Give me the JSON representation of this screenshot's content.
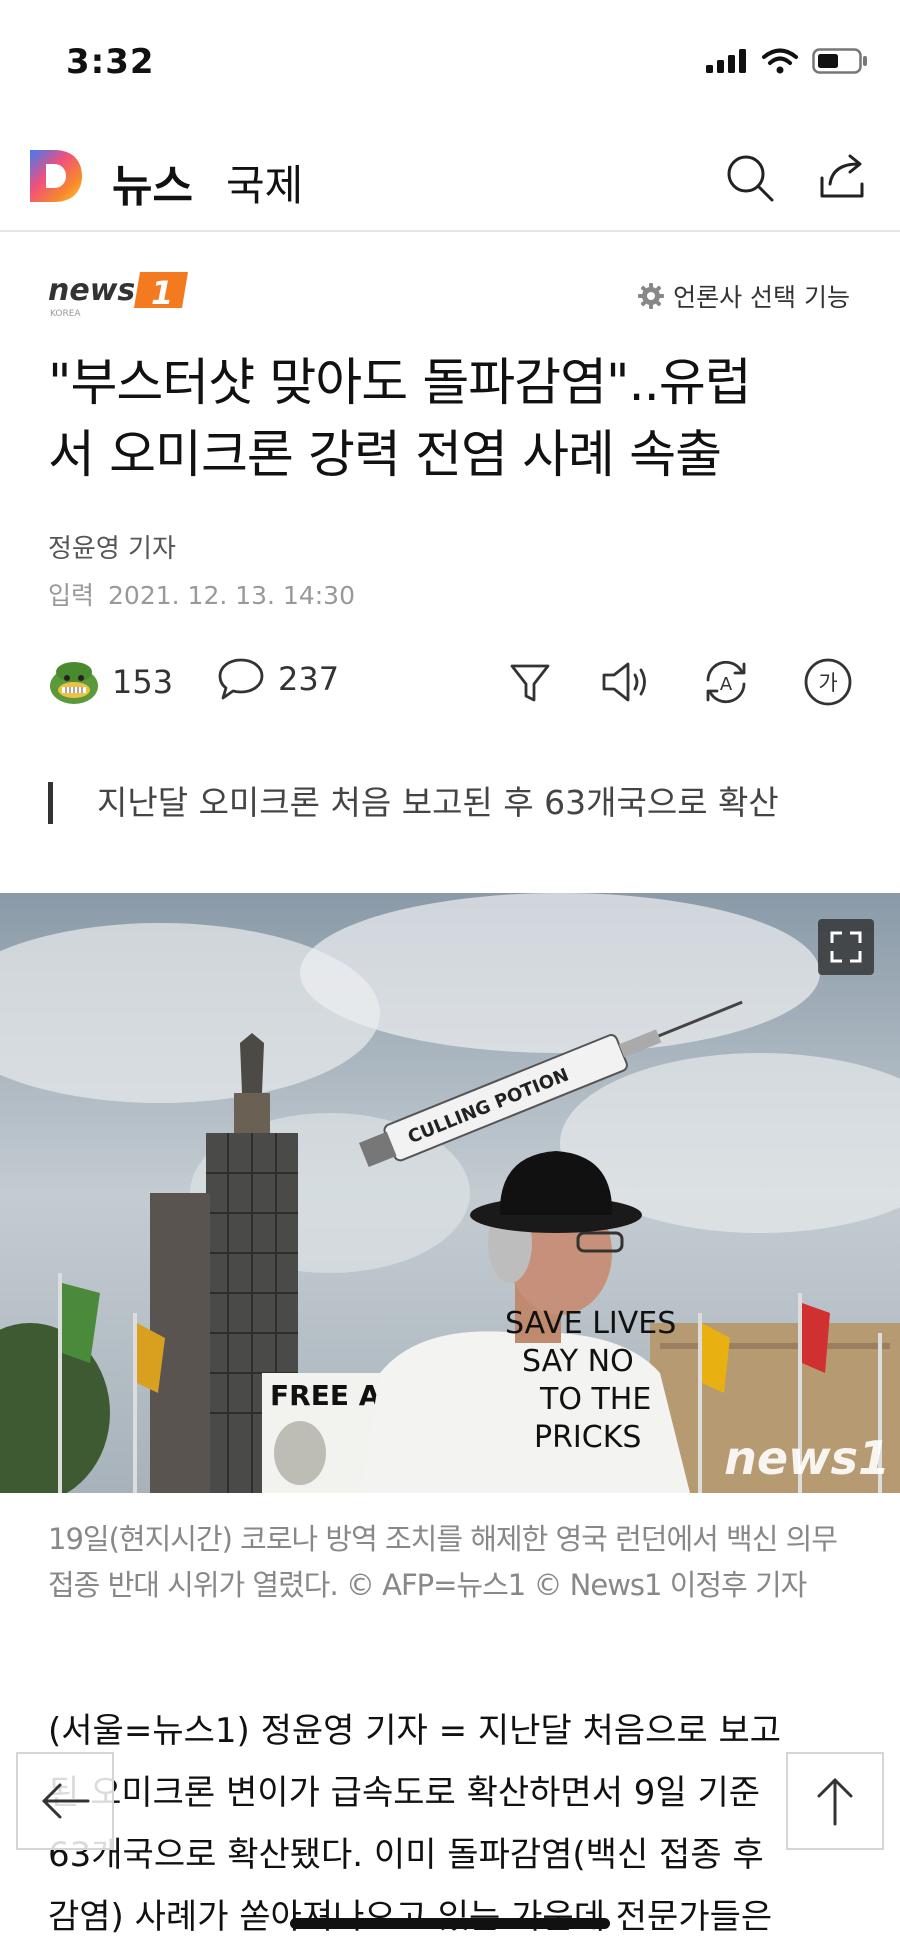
{
  "status_bar": {
    "time": "3:32"
  },
  "header": {
    "app_name": "뉴스",
    "section": "국제"
  },
  "press": {
    "name": "news1",
    "sub": "KOREA",
    "select_label": "언론사 선택 기능"
  },
  "article": {
    "headline_line1": "\"부스터샷 맞아도 돌파감염\"..유럽",
    "headline_line2": "서 오미크론 강력 전염 사례 속출",
    "reporter": "정윤영 기자",
    "date_label": "입력",
    "date_value": "2021. 12. 13. 14:30",
    "summary": "지난달 오미크론 처음 보고된 후 63개국으로 확산",
    "caption_line1": "19일(현지시간) 코로나 방역 조치를 해제한 영국 런던에서 백신 의무",
    "caption_line2": "접종 반대 시위가 열렸다. © AFP=뉴스1 © News1 이정후 기자",
    "body_line1": "(서울=뉴스1) 정윤영 기자 = 지난달 처음으로 보고",
    "body_line2": "된 오미크론 변이가 급속도로 확산하면서 9일 기준",
    "body_line3": "63개국으로 확산됐다. 이미 돌파감염(백신 접종 후",
    "body_line4": "감염) 사례가 쏟아져나오고 있는 가운데 전문가들은"
  },
  "actions": {
    "reaction_count": "153",
    "comment_count": "237"
  },
  "photo": {
    "syringe_text": "CULLING POTION",
    "shirt_line1": "SAVE LIVES",
    "shirt_line2": "SAY NO",
    "shirt_line3": "TO THE",
    "shirt_line4": "PRICKS",
    "sign_text": "FREE AS",
    "watermark": "news1"
  },
  "colors": {
    "accent": "#f47a20",
    "text": "#111111",
    "muted": "#999999"
  },
  "icons": [
    "daum-logo-icon",
    "search-icon",
    "share-icon",
    "gear-icon",
    "reaction-icon",
    "comment-icon",
    "filter-icon",
    "speaker-icon",
    "translate-icon",
    "font-size-icon",
    "expand-icon",
    "back-arrow-icon",
    "scroll-top-icon"
  ]
}
